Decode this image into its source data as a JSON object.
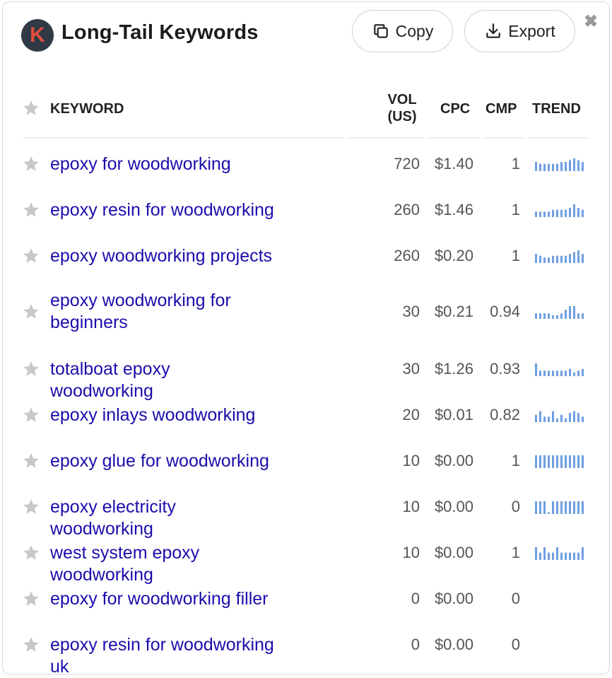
{
  "header": {
    "title": "Long-Tail Keywords",
    "logo_letter": "K",
    "copy_label": "Copy",
    "export_label": "Export"
  },
  "columns": {
    "keyword": "KEYWORD",
    "vol_line1": "VOL",
    "vol_line2": "(US)",
    "cpc": "CPC",
    "cmp": "CMP",
    "trend": "TREND"
  },
  "colors": {
    "link": "#1a0dab",
    "trend_bar": "#6f9fe0",
    "star": "#c8c8c8"
  },
  "rows": [
    {
      "keyword": "epoxy for woodworking",
      "vol": "720",
      "cpc": "$1.40",
      "cmp": "1",
      "trend": [
        5,
        4,
        4,
        4,
        4,
        4,
        5,
        5,
        6,
        7,
        6,
        5
      ]
    },
    {
      "keyword": "epoxy resin for woodworking",
      "vol": "260",
      "cpc": "$1.46",
      "cmp": "1",
      "trend": [
        3,
        3,
        3,
        3,
        4,
        4,
        4,
        4,
        5,
        7,
        5,
        4
      ]
    },
    {
      "keyword": "epoxy woodworking projects",
      "vol": "260",
      "cpc": "$0.20",
      "cmp": "1",
      "trend": [
        5,
        4,
        3,
        3,
        4,
        4,
        4,
        4,
        5,
        6,
        7,
        5
      ]
    },
    {
      "keyword": "epoxy woodworking for beginners",
      "vol": "30",
      "cpc": "$0.21",
      "cmp": "0.94",
      "trend": [
        3,
        3,
        3,
        3,
        2,
        2,
        3,
        5,
        7,
        7,
        3,
        3
      ]
    },
    {
      "keyword": "totalboat epoxy woodworking",
      "vol": "30",
      "cpc": "$1.26",
      "cmp": "0.93",
      "trend": [
        7,
        3,
        3,
        3,
        3,
        3,
        3,
        3,
        4,
        2,
        3,
        4
      ]
    },
    {
      "keyword": "epoxy inlays woodworking",
      "vol": "20",
      "cpc": "$0.01",
      "cmp": "0.82",
      "trend": [
        4,
        6,
        3,
        3,
        6,
        2,
        4,
        2,
        5,
        6,
        5,
        3
      ]
    },
    {
      "keyword": "epoxy glue for woodworking",
      "vol": "10",
      "cpc": "$0.00",
      "cmp": "1",
      "trend": [
        7,
        7,
        7,
        7,
        7,
        7,
        7,
        7,
        7,
        7,
        7,
        7
      ]
    },
    {
      "keyword": "epoxy electricity woodworking",
      "vol": "10",
      "cpc": "$0.00",
      "cmp": "0",
      "trend": [
        7,
        7,
        7,
        1,
        7,
        7,
        7,
        7,
        7,
        7,
        7,
        7
      ]
    },
    {
      "keyword": "west system epoxy woodworking",
      "vol": "10",
      "cpc": "$0.00",
      "cmp": "1",
      "trend": [
        7,
        4,
        7,
        4,
        4,
        7,
        4,
        4,
        4,
        4,
        4,
        7
      ]
    },
    {
      "keyword": "epoxy for woodworking filler",
      "vol": "0",
      "cpc": "$0.00",
      "cmp": "0",
      "trend": []
    },
    {
      "keyword": "epoxy resin for woodworking uk",
      "vol": "0",
      "cpc": "$0.00",
      "cmp": "0",
      "trend": []
    }
  ]
}
